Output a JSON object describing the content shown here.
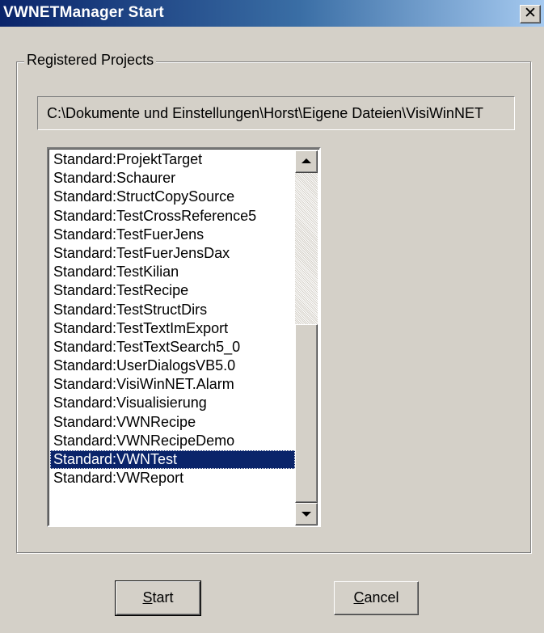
{
  "window": {
    "title": "VWNETManager Start",
    "close_glyph": "✕"
  },
  "group": {
    "label": "Registered Projects"
  },
  "path": {
    "value": "C:\\Dokumente und Einstellungen\\Horst\\Eigene Dateien\\VisiWinNET"
  },
  "list": {
    "items": [
      "Standard:ProjektTarget",
      "Standard:Schaurer",
      "Standard:StructCopySource",
      "Standard:TestCrossReference5",
      "Standard:TestFuerJens",
      "Standard:TestFuerJensDax",
      "Standard:TestKilian",
      "Standard:TestRecipe",
      "Standard:TestStructDirs",
      "Standard:TestTextImExport",
      "Standard:TestTextSearch5_0",
      "Standard:UserDialogsVB5.0",
      "Standard:VisiWinNET.Alarm",
      "Standard:Visualisierung",
      "Standard:VWNRecipe",
      "Standard:VWNRecipeDemo",
      "Standard:VWNTest",
      "Standard:VWReport"
    ],
    "selected_index": 16
  },
  "buttons": {
    "start_accel": "S",
    "start_rest": "tart",
    "cancel_accel": "C",
    "cancel_rest": "ancel"
  },
  "colors": {
    "selection": "#0a246a",
    "face": "#d4d0c8"
  },
  "icons": {
    "close": "close-icon",
    "scroll_up": "arrow-up-icon",
    "scroll_down": "arrow-down-icon"
  }
}
